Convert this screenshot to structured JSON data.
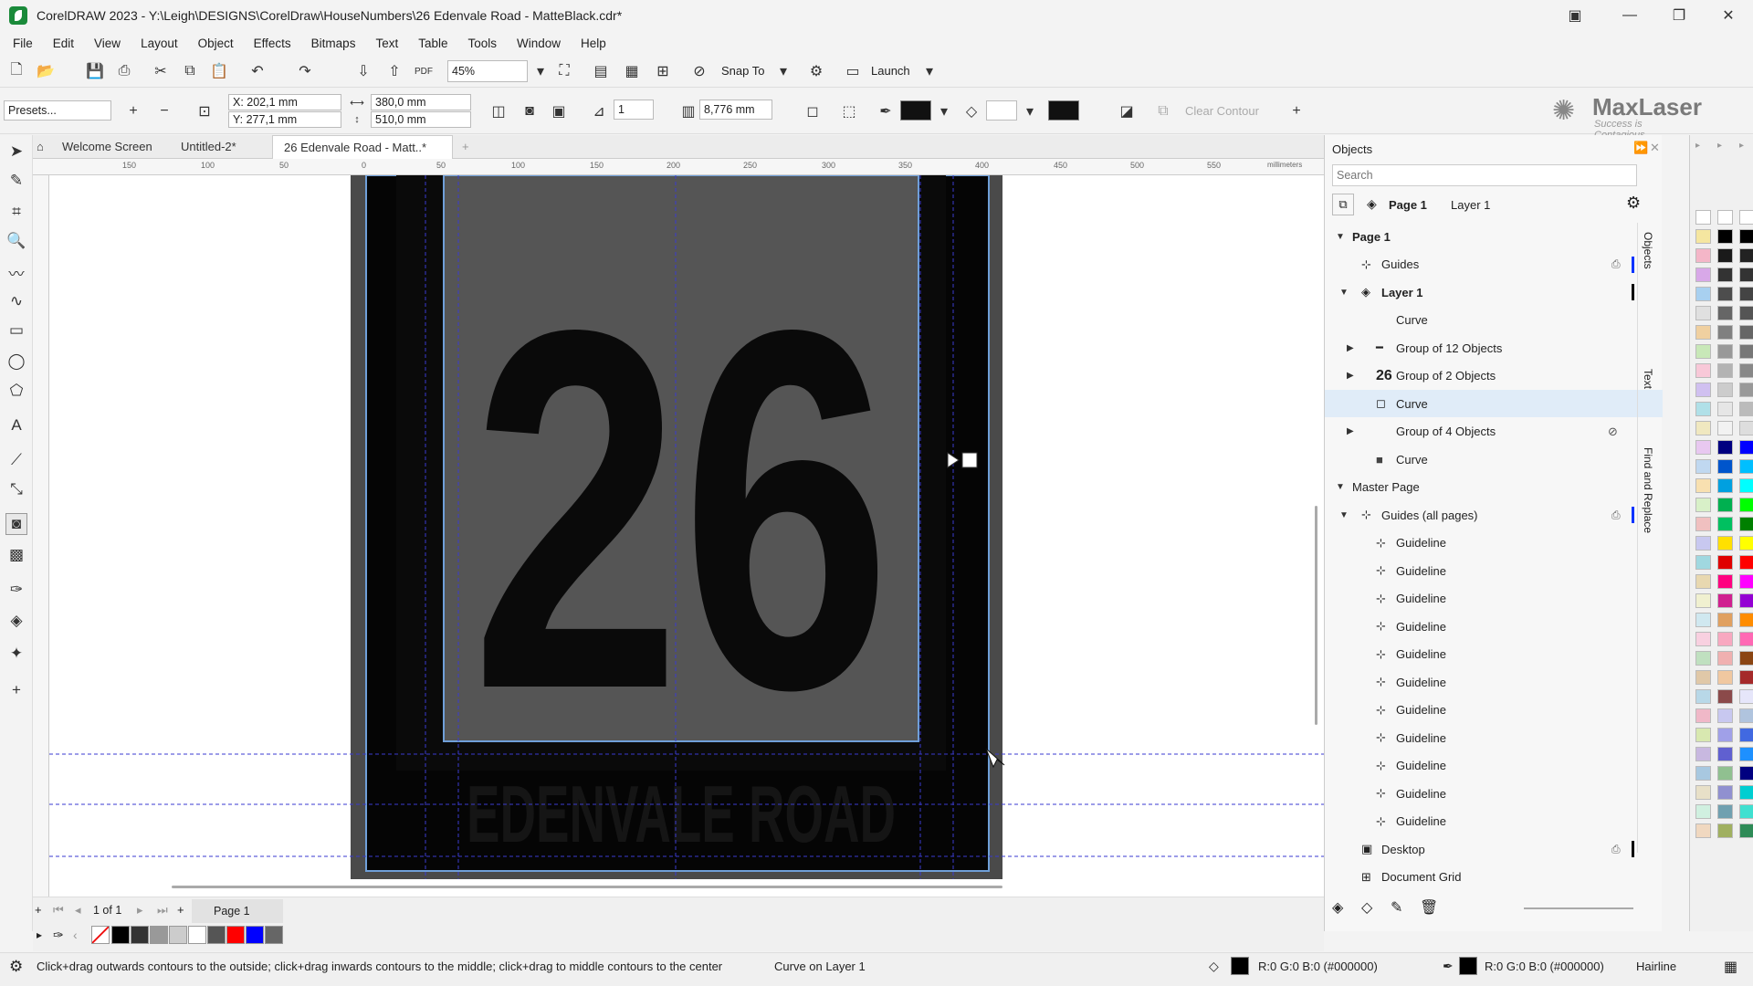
{
  "window": {
    "title": "CorelDRAW 2023 - Y:\\Leigh\\DESIGNS\\CorelDraw\\HouseNumbers\\26 Edenvale Road - MatteBlack.cdr*"
  },
  "menu": [
    "File",
    "Edit",
    "View",
    "Layout",
    "Object",
    "Effects",
    "Bitmaps",
    "Text",
    "Table",
    "Tools",
    "Window",
    "Help"
  ],
  "toolbar": {
    "zoom": "45%",
    "snap_label": "Snap To",
    "launch_label": "Launch"
  },
  "propbar": {
    "presets": "Presets...",
    "x": "X: 202,1 mm",
    "y": "Y: 277,1 mm",
    "w": "380,0 mm",
    "h": "510,0 mm",
    "steps": "1",
    "offset": "8,776 mm",
    "clear_contour": "Clear Contour"
  },
  "brand": {
    "name": "MaxLaser",
    "tagline": "Success is Contagious"
  },
  "tabs": [
    "Welcome Screen",
    "Untitled-2*",
    "26 Edenvale Road - Matt..*"
  ],
  "ruler": {
    "ticks": [
      "150",
      "100",
      "50",
      "0",
      "50",
      "100",
      "150",
      "200",
      "250",
      "300",
      "350",
      "400",
      "450",
      "500",
      "550"
    ],
    "unit": "millimeters"
  },
  "design": {
    "number": "26",
    "street": "EDENVALE ROAD"
  },
  "pagenav": {
    "counter": "1 of 1",
    "page_tab": "Page 1"
  },
  "docker": {
    "title": "Objects",
    "search_placeholder": "Search",
    "page_label": "Page 1",
    "layer_label": "Layer 1",
    "side_tabs": [
      "Objects",
      "Text",
      "Find and Replace"
    ],
    "tree": [
      {
        "label": "Page 1",
        "level": 0
      },
      {
        "label": "Guides",
        "level": 1
      },
      {
        "label": "Layer 1",
        "level": 1
      },
      {
        "label": "Curve",
        "level": 2
      },
      {
        "label": "Group of 12 Objects",
        "level": 2
      },
      {
        "label": "Group of 2 Objects",
        "level": 2
      },
      {
        "label": "Curve",
        "level": 2,
        "selected": true
      },
      {
        "label": "Group of 4 Objects",
        "level": 2
      },
      {
        "label": "Curve",
        "level": 2
      },
      {
        "label": "Master Page",
        "level": 0
      },
      {
        "label": "Guides (all pages)",
        "level": 1
      },
      {
        "label": "Guideline",
        "level": 2
      },
      {
        "label": "Guideline",
        "level": 2
      },
      {
        "label": "Guideline",
        "level": 2
      },
      {
        "label": "Guideline",
        "level": 2
      },
      {
        "label": "Guideline",
        "level": 2
      },
      {
        "label": "Guideline",
        "level": 2
      },
      {
        "label": "Guideline",
        "level": 2
      },
      {
        "label": "Guideline",
        "level": 2
      },
      {
        "label": "Guideline",
        "level": 2
      },
      {
        "label": "Guideline",
        "level": 2
      },
      {
        "label": "Guideline",
        "level": 2
      },
      {
        "label": "Desktop",
        "level": 1
      },
      {
        "label": "Document Grid",
        "level": 1
      }
    ]
  },
  "status": {
    "hint": "Click+drag outwards contours to the outside; click+drag inwards contours to the middle; click+drag to middle contours to the center",
    "object": "Curve on Layer 1",
    "fill": "R:0 G:0 B:0 (#000000)",
    "outline": "R:0 G:0 B:0 (#000000)",
    "outline_width": "Hairline"
  },
  "colors": {
    "accent": "#6f9fd8",
    "selection": "#e0ecf8",
    "guide": "#3a3ad0"
  },
  "doc_palette": [
    "#000000",
    "#333333",
    "#999999",
    "#cccccc",
    "#ffffff",
    "#555555",
    "#ff0000",
    "#0000ff",
    "#666666"
  ],
  "main_palette": [
    "#ffffff",
    "#000000",
    "#1a1a1a",
    "#333333",
    "#4d4d4d",
    "#666666",
    "#808080",
    "#999999",
    "#b3b3b3",
    "#cccccc",
    "#e6e6e6",
    "#f2f2f2",
    "#00008b",
    "#0000ff",
    "#00bfff",
    "#00ff00",
    "#008000",
    "#ffff00",
    "#ff0000",
    "#ff00ff",
    "#ff1493",
    "#9400d3",
    "#ff8c00",
    "#f4a460",
    "#ffb6c1",
    "#dda0dd",
    "#8b4513",
    "#a52a2a",
    "#e6e6fa",
    "#b0c4de",
    "#4169e1",
    "#1e90ff",
    "#000080",
    "#00ced1",
    "#40e0d0",
    "#7fffd4",
    "#2e8b57",
    "#556b2f",
    "#808000",
    "#bdb76b"
  ]
}
